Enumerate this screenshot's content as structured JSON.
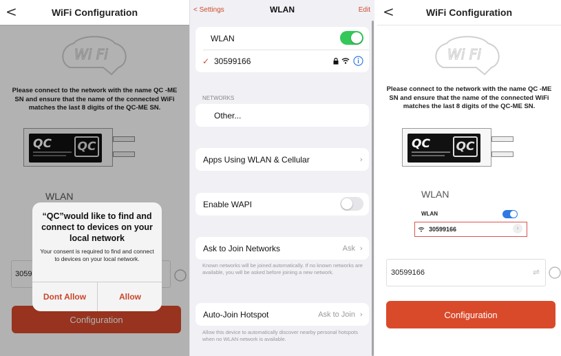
{
  "panel_left": {
    "header": {
      "back": "<",
      "title": "WiFi Configuration"
    },
    "logo_text": "Wi Fi",
    "instructions": "Please connect to the network with the name QC -ME SN and ensure that the name of the connected WiFi matches the last 8 digits of the QC-ME SN.",
    "device": {
      "logo_left": "QC",
      "logo_right": "QC",
      "connector_text": "IIIIII"
    },
    "wlan_label": "WLAN",
    "ssid_value": "3059",
    "configuration_button": "Configuration",
    "alert": {
      "title": "“QC”would like to find and connect to devices on your local network",
      "message": "Your consent is required to find and connect to devices on your local network.",
      "deny": "Dont Allow",
      "allow": "Allow"
    }
  },
  "panel_middle": {
    "header": {
      "back": "< Settings",
      "title": "WLAN",
      "edit": "Edit"
    },
    "wlan_row": {
      "label": "WLAN",
      "enabled": true
    },
    "connected": {
      "check": "✓",
      "name": "30599166"
    },
    "networks_header": "NETWORKS",
    "other": "Other...",
    "apps_using": "Apps Using WLAN & Cellular",
    "enable_wapi": {
      "label": "Enable WAPI",
      "enabled": false
    },
    "ask_to_join": {
      "label": "Ask to Join Networks",
      "value": "Ask"
    },
    "ask_note": "Known networks will be joined automatically. If no known networks are available, you will be asked before joining a new network.",
    "auto_join": {
      "label": "Auto-Join Hotspot",
      "value": "Ask to Join"
    },
    "auto_note": "Allow this device to automatically discover nearby personal hotspots when no WLAN network is available."
  },
  "panel_right": {
    "header": {
      "back": "<",
      "title": "WiFi Configuration"
    },
    "logo_text": "Wi Fi",
    "instructions": "Please connect to the network with the name QC -ME SN and ensure that the name of the connected WiFi matches the last 8 digits of the QC-ME SN.",
    "device": {
      "logo_left": "QC",
      "logo_right": "QC",
      "connector_text": "IIIIII"
    },
    "inset": {
      "title": "WLAN",
      "wlan": "WLAN",
      "network": "30599166"
    },
    "ssid_value": "30599166",
    "configuration_button": "Configuration"
  },
  "colors": {
    "accent": "#d94a2b",
    "ios_green": "#34c759",
    "ios_blue": "#2f7ae5",
    "link_red": "#d14a2a"
  },
  "icons": [
    "chevron-left-icon",
    "wifi-icon",
    "lock-icon",
    "info-icon",
    "check-icon",
    "chevron-right-icon",
    "swap-icon",
    "refresh-icon"
  ]
}
